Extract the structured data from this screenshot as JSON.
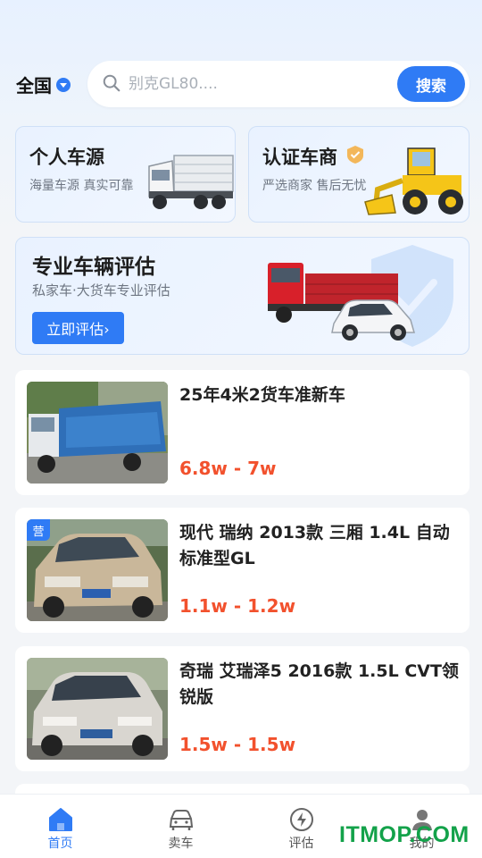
{
  "header": {
    "region": "全国",
    "search_placeholder": "别克GL80....",
    "search_button": "搜索"
  },
  "cards": {
    "personal": {
      "title": "个人车源",
      "subtitle": "海量车源 真实可靠"
    },
    "dealer": {
      "title": "认证车商",
      "subtitle": "严选商家 售后无忧"
    },
    "evaluation": {
      "title": "专业车辆评估",
      "subtitle": "私家车·大货车专业评估",
      "button": "立即评估›"
    }
  },
  "listings": [
    {
      "title": "25年4米2货车准新车",
      "price": "6.8w - 7w",
      "badge": ""
    },
    {
      "title": "现代 瑞纳 2013款 三厢 1.4L 自动标准型GL",
      "price": "1.1w - 1.2w",
      "badge": "营"
    },
    {
      "title": "奇瑞 艾瑞泽5 2016款 1.5L CVT领锐版",
      "price": "1.5w - 1.5w",
      "badge": ""
    }
  ],
  "tabbar": {
    "items": [
      {
        "label": "首页",
        "icon": "home-icon",
        "active": true
      },
      {
        "label": "卖车",
        "icon": "car-icon",
        "active": false
      },
      {
        "label": "评估",
        "icon": "lightning-icon",
        "active": false
      },
      {
        "label": "我的",
        "icon": "user-icon",
        "active": false
      }
    ]
  },
  "watermark": "ITMOP.COM",
  "colors": {
    "accent": "#2f7bf5",
    "price": "#f2512d",
    "watermark": "#13a24a"
  }
}
